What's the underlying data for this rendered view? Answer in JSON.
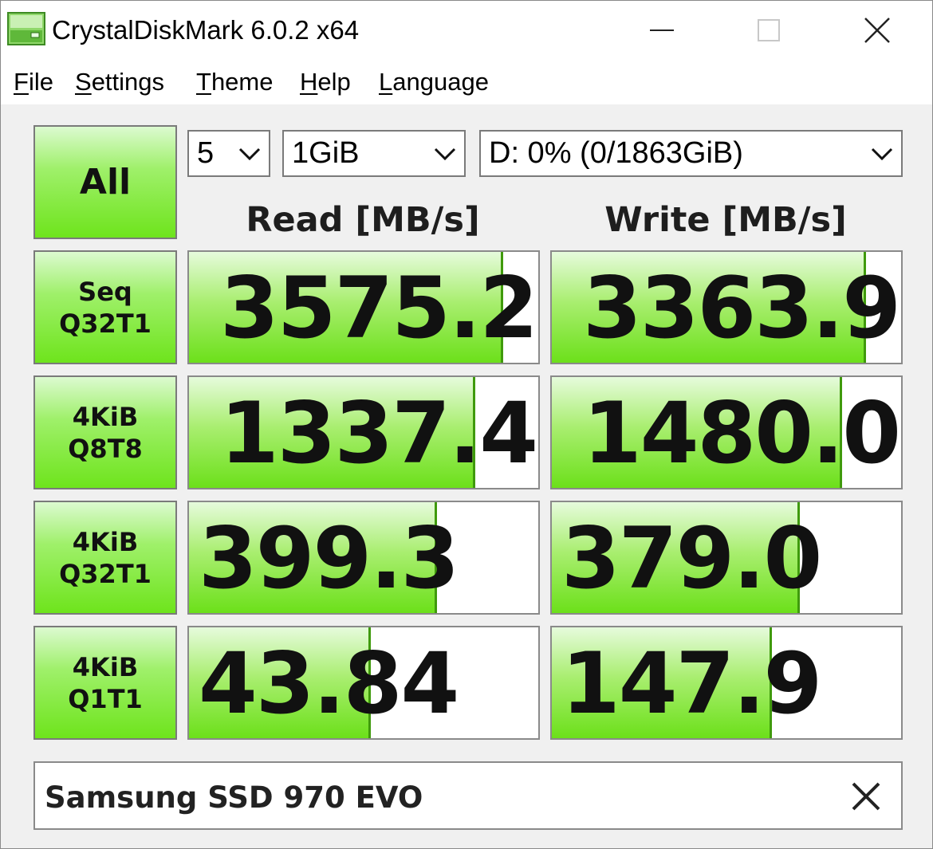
{
  "window": {
    "title": "CrystalDiskMark 6.0.2 x64",
    "icon": "disk-icon",
    "controls": [
      "minimize",
      "maximize",
      "close"
    ]
  },
  "menu": [
    {
      "label": "File",
      "mnemonic": "F",
      "rest": "ile"
    },
    {
      "label": "Settings",
      "mnemonic": "S",
      "rest": "ettings"
    },
    {
      "label": "Theme",
      "mnemonic": "T",
      "rest": "heme"
    },
    {
      "label": "Help",
      "mnemonic": "H",
      "rest": "elp"
    },
    {
      "label": "Language",
      "mnemonic": "L",
      "rest": "anguage"
    }
  ],
  "controls": {
    "all_label": "All",
    "count_select": "5",
    "size_select": "1GiB",
    "drive_select": "D: 0% (0/1863GiB)"
  },
  "headers": {
    "read": "Read [MB/s]",
    "write": "Write [MB/s]"
  },
  "rows": [
    {
      "line1": "Seq",
      "line2": "Q32T1",
      "read": "3575.2",
      "write": "3363.9",
      "read_fill": 0.9,
      "write_fill": 0.9
    },
    {
      "line1": "4KiB",
      "line2": "Q8T8",
      "read": "1337.4",
      "write": "1480.0",
      "read_fill": 0.82,
      "write_fill": 0.83
    },
    {
      "line1": "4KiB",
      "line2": "Q32T1",
      "read": "399.3",
      "write": "379.0",
      "read_fill": 0.71,
      "write_fill": 0.71
    },
    {
      "line1": "4KiB",
      "line2": "Q1T1",
      "read": "43.84",
      "write": "147.9",
      "read_fill": 0.52,
      "write_fill": 0.63
    }
  ],
  "comment": "Samsung SSD 970 EVO",
  "colors": {
    "accent_green": "#6ee41c",
    "bar_edge": "#3f9a0c",
    "border": "#8a8a8a"
  }
}
